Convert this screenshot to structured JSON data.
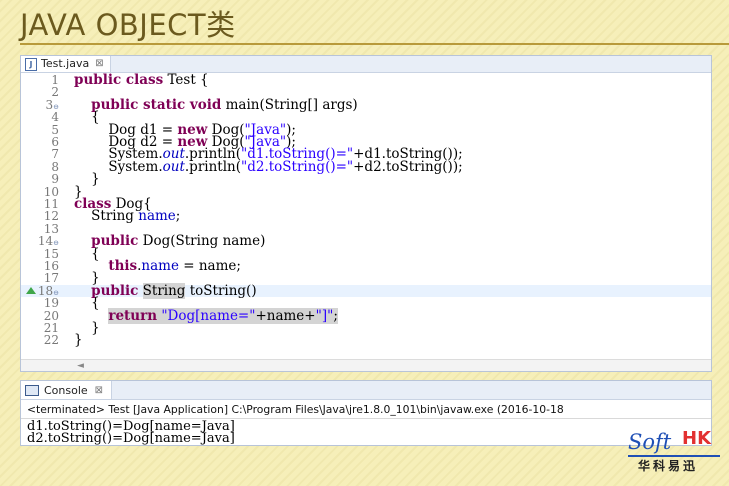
{
  "slide": {
    "title": "JAVA OBJECT类"
  },
  "editor": {
    "tab_label": "Test.java",
    "tab_close": "⊠",
    "lines": [
      {
        "n": "1",
        "segments": [
          {
            "t": "public class",
            "c": "kw"
          },
          {
            "t": " Test {",
            "c": ""
          }
        ]
      },
      {
        "n": "2",
        "segments": []
      },
      {
        "n": "3",
        "fold": "⊖",
        "segments": [
          {
            "t": "    ",
            "c": ""
          },
          {
            "t": "public static void",
            "c": "kw"
          },
          {
            "t": " main(String[] args)",
            "c": ""
          }
        ]
      },
      {
        "n": "4",
        "segments": [
          {
            "t": "    {",
            "c": ""
          }
        ]
      },
      {
        "n": "5",
        "segments": [
          {
            "t": "        Dog d1 = ",
            "c": ""
          },
          {
            "t": "new",
            "c": "kw"
          },
          {
            "t": " Dog(",
            "c": ""
          },
          {
            "t": "\"Java\"",
            "c": "str"
          },
          {
            "t": ");",
            "c": ""
          }
        ]
      },
      {
        "n": "6",
        "segments": [
          {
            "t": "        Dog d2 = ",
            "c": ""
          },
          {
            "t": "new",
            "c": "kw"
          },
          {
            "t": " Dog(",
            "c": ""
          },
          {
            "t": "\"Java\"",
            "c": "str"
          },
          {
            "t": ");",
            "c": ""
          }
        ]
      },
      {
        "n": "7",
        "segments": [
          {
            "t": "        System.",
            "c": ""
          },
          {
            "t": "out",
            "c": "fldi"
          },
          {
            "t": ".println(",
            "c": ""
          },
          {
            "t": "\"d1.toString()=\"",
            "c": "str"
          },
          {
            "t": "+d1.toString());",
            "c": ""
          }
        ]
      },
      {
        "n": "8",
        "segments": [
          {
            "t": "        System.",
            "c": ""
          },
          {
            "t": "out",
            "c": "fldi"
          },
          {
            "t": ".println(",
            "c": ""
          },
          {
            "t": "\"d2.toString()=\"",
            "c": "str"
          },
          {
            "t": "+d2.toString());",
            "c": ""
          }
        ]
      },
      {
        "n": "9",
        "segments": [
          {
            "t": "    }",
            "c": ""
          }
        ]
      },
      {
        "n": "10",
        "segments": [
          {
            "t": "}",
            "c": ""
          }
        ]
      },
      {
        "n": "11",
        "segments": [
          {
            "t": "class",
            "c": "kw"
          },
          {
            "t": " Dog{",
            "c": ""
          }
        ]
      },
      {
        "n": "12",
        "segments": [
          {
            "t": "    String ",
            "c": ""
          },
          {
            "t": "name",
            "c": "fld"
          },
          {
            "t": ";",
            "c": ""
          }
        ]
      },
      {
        "n": "13",
        "segments": []
      },
      {
        "n": "14",
        "fold": "⊖",
        "segments": [
          {
            "t": "    ",
            "c": ""
          },
          {
            "t": "public",
            "c": "kw"
          },
          {
            "t": " Dog(String name)",
            "c": ""
          }
        ]
      },
      {
        "n": "15",
        "segments": [
          {
            "t": "    {",
            "c": ""
          }
        ]
      },
      {
        "n": "16",
        "segments": [
          {
            "t": "        ",
            "c": ""
          },
          {
            "t": "this",
            "c": "kw"
          },
          {
            "t": ".",
            "c": ""
          },
          {
            "t": "name",
            "c": "fld"
          },
          {
            "t": " = name;",
            "c": ""
          }
        ]
      },
      {
        "n": "17",
        "segments": [
          {
            "t": "    }",
            "c": ""
          }
        ]
      },
      {
        "n": "18",
        "fold": "⊖",
        "marker": true,
        "current": true,
        "segments": [
          {
            "t": "    ",
            "c": ""
          },
          {
            "t": "public",
            "c": "kw"
          },
          {
            "t": " ",
            "c": ""
          },
          {
            "t": "String",
            "c": "sel"
          },
          {
            "t": " toString()",
            "c": ""
          }
        ]
      },
      {
        "n": "19",
        "segments": [
          {
            "t": "    {",
            "c": ""
          }
        ]
      },
      {
        "n": "20",
        "segments": [
          {
            "t": "        ",
            "c": ""
          },
          {
            "t": "return",
            "c": "kw sel"
          },
          {
            "t": " ",
            "c": "sel"
          },
          {
            "t": "\"Dog[name=\"",
            "c": "str sel"
          },
          {
            "t": "+name+",
            "c": "sel"
          },
          {
            "t": "\"]\"",
            "c": "str sel"
          },
          {
            "t": ";",
            "c": "sel"
          }
        ]
      },
      {
        "n": "21",
        "segments": [
          {
            "t": "    }",
            "c": ""
          }
        ]
      },
      {
        "n": "22",
        "segments": [
          {
            "t": "}",
            "c": ""
          }
        ]
      }
    ],
    "scroll_arrow": "◄"
  },
  "console": {
    "tab_label": "Console",
    "tab_close": "⊠",
    "status": "<terminated> Test [Java Application] C:\\Program Files\\Java\\jre1.8.0_101\\bin\\javaw.exe (2016-10-18 ",
    "output": [
      "d1.toString()=Dog[name=Java]",
      "d2.toString()=Dog[name=Java]"
    ]
  },
  "logo": {
    "soft": "Soft",
    "hk": "HK",
    "cn": "华科易迅"
  }
}
